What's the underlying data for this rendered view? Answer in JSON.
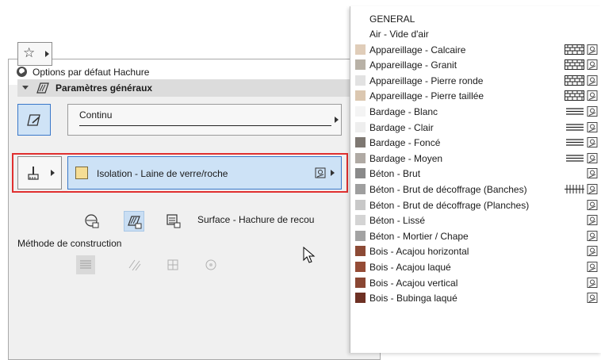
{
  "dialog": {
    "title": "Options par défaut Hachure",
    "section_title": "Paramètres généraux",
    "line_type": "Continu",
    "fill_name": "Isolation - Laine de verre/roche",
    "fill_swatch_color": "#f5dd95",
    "surface_label": "Surface - Hachure de recou",
    "method_label": "Méthode de construction"
  },
  "dropdown": {
    "group_header": "GENERAL",
    "items": [
      {
        "label": "Air - Vide d'air",
        "color": "",
        "pattern": "none"
      },
      {
        "label": "Appareillage - Calcaire",
        "color": "#e0cdb9",
        "pattern": "masonry"
      },
      {
        "label": "Appareillage - Granit",
        "color": "#b8b1a6",
        "pattern": "masonry"
      },
      {
        "label": "Appareillage - Pierre ronde",
        "color": "#e2e2e2",
        "pattern": "masonry"
      },
      {
        "label": "Appareillage - Pierre taillée",
        "color": "#dbc7b0",
        "pattern": "masonry"
      },
      {
        "label": "Bardage - Blanc",
        "color": "#f4f4f4",
        "pattern": "lines"
      },
      {
        "label": "Bardage - Clair",
        "color": "#eeeeee",
        "pattern": "lines"
      },
      {
        "label": "Bardage - Foncé",
        "color": "#7e7872",
        "pattern": "lines"
      },
      {
        "label": "Bardage - Moyen",
        "color": "#b0aaa4",
        "pattern": "lines"
      },
      {
        "label": "Béton - Brut",
        "color": "#8a8a8a",
        "pattern": "none"
      },
      {
        "label": "Béton - Brut de décoffrage (Banches)",
        "color": "#9f9f9f",
        "pattern": "grid"
      },
      {
        "label": "Béton - Brut de décoffrage (Planches)",
        "color": "#c8c8c8",
        "pattern": "none"
      },
      {
        "label": "Béton - Lissé",
        "color": "#d4d4d4",
        "pattern": "none"
      },
      {
        "label": "Béton - Mortier / Chape",
        "color": "#a3a3a3",
        "pattern": "none"
      },
      {
        "label": "Bois - Acajou horizontal",
        "color": "#8c4a35",
        "pattern": "none"
      },
      {
        "label": "Bois - Acajou laqué",
        "color": "#954c36",
        "pattern": "none"
      },
      {
        "label": "Bois - Acajou vertical",
        "color": "#8a4733",
        "pattern": "none"
      },
      {
        "label": "Bois - Bubinga laqué",
        "color": "#6e3124",
        "pattern": "none"
      }
    ]
  }
}
